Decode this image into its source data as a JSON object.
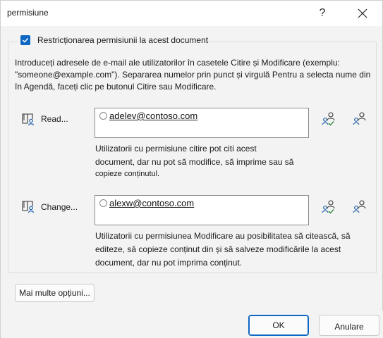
{
  "window": {
    "title": "permisiune",
    "help_label": "?"
  },
  "restrict": {
    "label": "Restricționarea permisiunii la acest document",
    "checked": true
  },
  "intro": {
    "text": "Introduceți adresele de e-mail ale utilizatorilor în casetele Citire și Modificare (exemplu: \"someone@example.com\"). Separarea numelor prin punct și virgulă Pentru a selecta nume din în Agendă, faceți clic pe butonul Citire sau Modificare."
  },
  "read": {
    "label": "Read...",
    "email": "adelev@contoso.com",
    "description_line1": "Utilizatorii cu permisiune citire pot citi acest",
    "description_line2": "document, dar nu pot să modifice, să imprime sau să",
    "description_line3": "copieze conținutul."
  },
  "change": {
    "label": "Change...",
    "email": "alexw@contoso.com",
    "description_line1": "Utilizatorii cu permisiunea Modificare au posibilitatea să citească, să",
    "description_line2": "editeze, să copieze conținut din și să salveze modificările la acest",
    "description_line3": "document, dar nu pot imprima conținut."
  },
  "buttons": {
    "more_options": "Mai multe opțiuni...",
    "ok": "OK",
    "cancel": "Anulare"
  },
  "colors": {
    "accent": "#0f67c4",
    "icon_blue": "#1f5fa8",
    "icon_green": "#2e8b3a"
  }
}
